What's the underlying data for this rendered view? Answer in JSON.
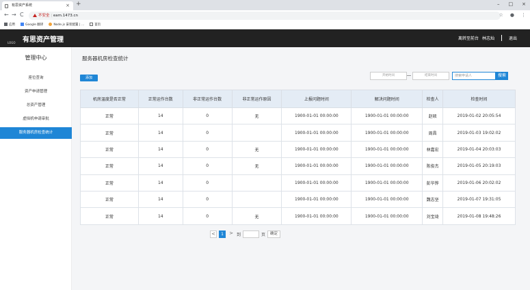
{
  "browser": {
    "tab_title": "有思资产系统",
    "tab_close": "×",
    "new_tab": "+",
    "window_controls": [
      "–",
      "□",
      "×"
    ],
    "back": "←",
    "forward": "→",
    "reload": "C",
    "security_label": "不安全",
    "url": "eam.1473.cn",
    "star": "☆",
    "profile": "●",
    "menu": "⋮",
    "bookmarks": [
      "应用",
      "Google 翻译",
      "Node.js 安装配置 | ...",
      "首页"
    ]
  },
  "header": {
    "logo": "LOGO",
    "brand": "有思资产管理",
    "right_links": [
      "离转至前台",
      "林志灿",
      "退出"
    ]
  },
  "sidebar": {
    "title": "管理中心",
    "items": [
      {
        "label": "座位查询",
        "active": false
      },
      {
        "label": "资产申请管理",
        "active": false
      },
      {
        "label": "总资产管理",
        "active": false
      },
      {
        "label": "虚拟机申请审批",
        "active": false
      },
      {
        "label": "服务器机房检查统计",
        "active": true
      }
    ]
  },
  "main": {
    "title": "服务器机房检查统计",
    "add_label": "添加",
    "start_placeholder": "开始时间",
    "end_placeholder": "结束时间",
    "search_placeholder": "搜索申请人",
    "search_label": "搜索",
    "table": {
      "headers": [
        "机房温度是否正常",
        "正常运作台数",
        "非正常运作台数",
        "非正常运作原因",
        "上报问题时间",
        "解决问题时间",
        "检查人",
        "检查时间"
      ],
      "rows": [
        [
          "正常",
          "14",
          "0",
          "无",
          "1900-01-01 00:00:00",
          "1900-01-01 00:00:00",
          "赵硕",
          "2019-01-02 20:05:54"
        ],
        [
          "正常",
          "14",
          "0",
          "",
          "1900-01-01 00:00:00",
          "1900-01-01 00:00:00",
          "周昌",
          "2019-01-03 19:02:02"
        ],
        [
          "正常",
          "14",
          "0",
          "无",
          "1900-01-01 00:00:00",
          "1900-01-01 00:00:00",
          "林嘉宏",
          "2019-01-04 20:03:03"
        ],
        [
          "正常",
          "14",
          "0",
          "无",
          "1900-01-01 00:00:00",
          "1900-01-01 00:00:00",
          "陈俊杰",
          "2019-01-05 20:19:03"
        ],
        [
          "正常",
          "14",
          "0",
          "",
          "1900-01-01 00:00:00",
          "1900-01-01 00:00:00",
          "彭华铧",
          "2019-01-06 20:02:02"
        ],
        [
          "正常",
          "14",
          "0",
          "",
          "1900-01-01 00:00:00",
          "1900-01-01 00:00:00",
          "魏志坚",
          "2019-01-07 19:31:05"
        ],
        [
          "正常",
          "14",
          "0",
          "无",
          "1900-01-01 00:00:00",
          "1900-01-01 00:00:00",
          "刘宝琦",
          "2019-01-08 19:48:26"
        ]
      ]
    },
    "pager": {
      "prev": "<",
      "current": "1",
      "next": ">",
      "goto_label": "到",
      "page_label": "页",
      "confirm": "确定"
    }
  },
  "colors": {
    "accent": "#1f86d6",
    "header_bg": "#222222",
    "table_header_bg": "#e4ecf5"
  }
}
